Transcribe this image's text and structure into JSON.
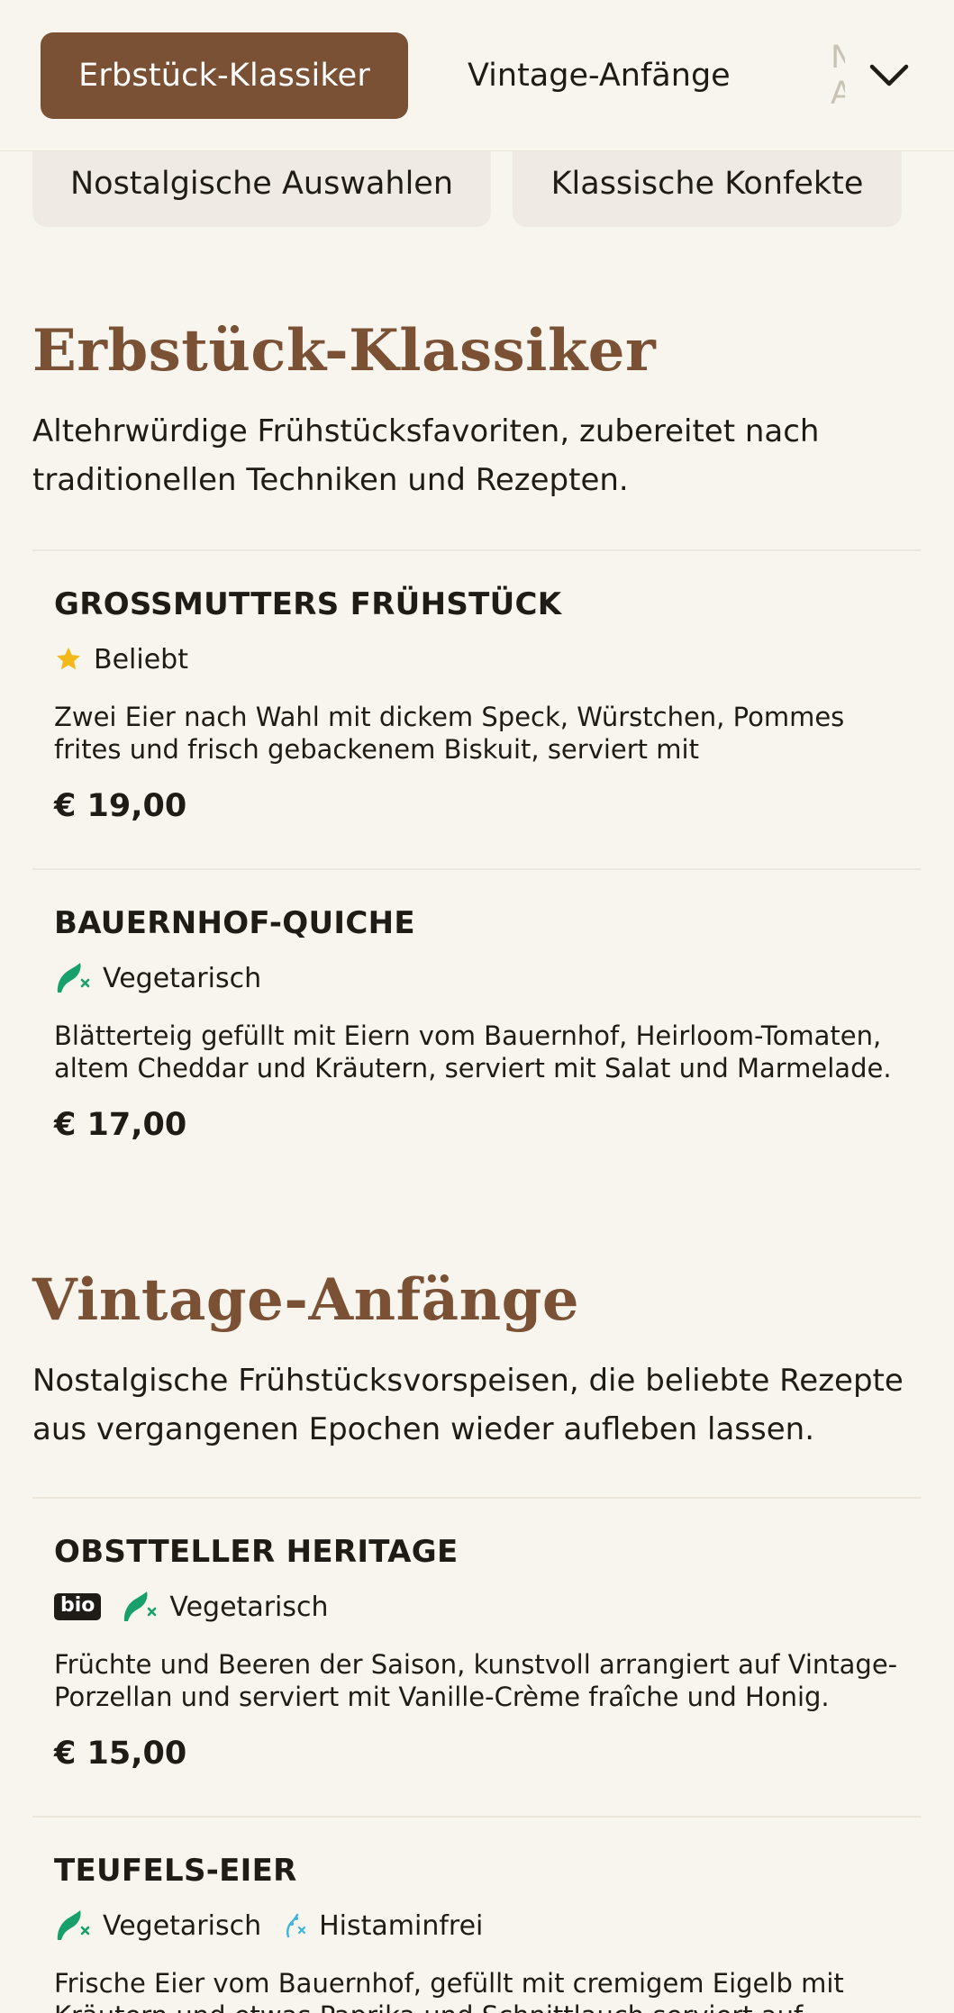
{
  "nav": {
    "tabs": [
      {
        "label": "Erbstück-Klassiker"
      },
      {
        "label": "Vintage-Anfänge"
      },
      {
        "label": "Nostalgische Auswahlen"
      }
    ],
    "expand_icon": "chevron-down-icon",
    "subtabs": [
      {
        "label": "Nostalgische Auswahlen"
      },
      {
        "label": "Klassische Konfekte"
      }
    ]
  },
  "colors": {
    "brand": "#7a5134",
    "star": "#f3b81a",
    "vegetarian": "#17a06b",
    "histamine": "#38b7d8"
  },
  "sections": [
    {
      "title": "Erbstück-Klassiker",
      "description": "Altehrwürdige Frühstücksfavoriten, zubereitet nach traditionellen Techniken und Rezepten.",
      "items": [
        {
          "name": "GROSSMUTTERS FRÜHSTÜCK",
          "tags": [
            {
              "icon": "star-icon",
              "label": "Beliebt"
            }
          ],
          "description": "Zwei Eier nach Wahl mit dickem Speck, Würstchen, Pommes frites und frisch gebackenem Biskuit, serviert mit hausgemachter…",
          "price": "€ 19,00"
        },
        {
          "name": "BAUERNHOF-QUICHE",
          "tags": [
            {
              "icon": "vegetarian-icon",
              "label": "Vegetarisch"
            }
          ],
          "description": "Blätterteig gefüllt mit Eiern vom Bauernhof, Heirloom-Tomaten, altem Cheddar und Kräutern, serviert mit Salat und Marmelade.",
          "price": "€ 17,00"
        }
      ]
    },
    {
      "title": "Vintage-Anfänge",
      "description": "Nostalgische Frühstücksvorspeisen, die beliebte Rezepte aus vergangenen Epochen wieder aufleben lassen.",
      "items": [
        {
          "name": "OBSTTELLER HERITAGE",
          "badge": "bio",
          "tags": [
            {
              "icon": "vegetarian-icon",
              "label": "Vegetarisch"
            }
          ],
          "description": "Früchte und Beeren der Saison, kunstvoll arrangiert auf Vintage-Porzellan und serviert mit Vanille-Crème fraîche und Honig.",
          "price": "€ 15,00"
        },
        {
          "name": "TEUFELS-EIER",
          "tags": [
            {
              "icon": "vegetarian-icon",
              "label": "Vegetarisch"
            },
            {
              "icon": "histamine-free-icon",
              "label": "Histaminfrei"
            }
          ],
          "description": "Frische Eier vom Bauernhof, gefüllt mit cremigem Eigelb mit Kräutern und etwas Paprika und Schnittlauch serviert auf…"
        }
      ]
    }
  ]
}
